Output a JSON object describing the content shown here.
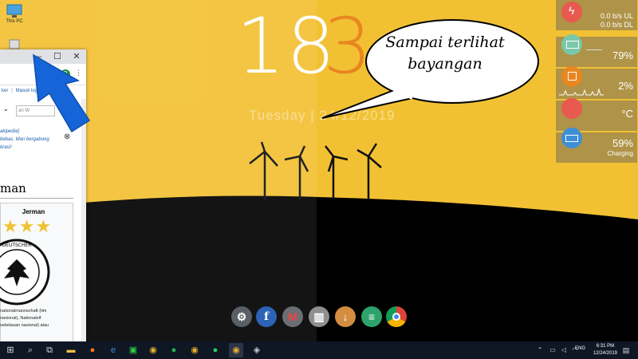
{
  "desktop": {
    "icons": [
      {
        "label": "This PC",
        "icon": "monitor-icon"
      },
      {
        "label": "",
        "icon": "recycle-bin-icon"
      }
    ]
  },
  "clock": {
    "hours": "18",
    "minutes": "3",
    "date": "Tuesday | 24/12/2019"
  },
  "callout": {
    "line1": "Sampai terlihat",
    "line2": "bayangan"
  },
  "browser": {
    "controls": {
      "minimize": "–",
      "maximize": "☐",
      "close": "✕"
    },
    "profile_initial": "P",
    "bookmarks": "ker  ⋮  Masuk log",
    "search_placeholder": "ari W",
    "notice": "akipedia]\n bebas. Mari bergabung\nbrasi!",
    "article_title": "man",
    "infobox_title": "Jerman",
    "stars": "★★★",
    "crest_text": "DEUTSCHER FUSSBALL-BUND",
    "article_text": "nationalmannschaft (tim\nnasional), Nationalelf\nsebelasan nasional) atau"
  },
  "widgets": {
    "network": {
      "ul": "0.0 b/s  UL",
      "dl": "0.0 b/s  DL"
    },
    "ram": {
      "value": "79%"
    },
    "cpu": {
      "value": "2%"
    },
    "temp": {
      "value": "°C"
    },
    "battery": {
      "value": "59%",
      "status": "Charging"
    }
  },
  "dock": {
    "items": [
      {
        "icon": "settings-icon",
        "color": "#5a5f66",
        "glyph": "⚙"
      },
      {
        "icon": "facebook-icon",
        "color": "#2c63b5",
        "glyph": "f"
      },
      {
        "icon": "gmail-icon",
        "color": "#6b6f73",
        "glyph": "M"
      },
      {
        "icon": "files-icon",
        "color": "#8f8f8f",
        "glyph": "▥"
      },
      {
        "icon": "download-icon",
        "color": "#d38c40",
        "glyph": "↓"
      },
      {
        "icon": "docs-icon",
        "color": "#2ea26b",
        "glyph": "≡"
      },
      {
        "icon": "chrome-icon",
        "color": "#e8e8e8",
        "glyph": "◉"
      }
    ]
  },
  "taskbar": {
    "time": "6:31 PM",
    "date": "12/24/2019",
    "lang": "ENG",
    "items": [
      "start-icon",
      "search-icon",
      "task-view-icon",
      "file-explorer-icon",
      "firefox-icon",
      "edge-icon",
      "line-icon",
      "chrome-icon",
      "spotify-icon",
      "chrome-icon",
      "whatsapp-icon",
      "chrome-icon",
      "app-icon"
    ]
  },
  "colors": {
    "wallpaper": "#f2c133",
    "minutes_accent": "#e8861f",
    "taskbar": "#0f1725",
    "arrow": "#1565d8"
  }
}
